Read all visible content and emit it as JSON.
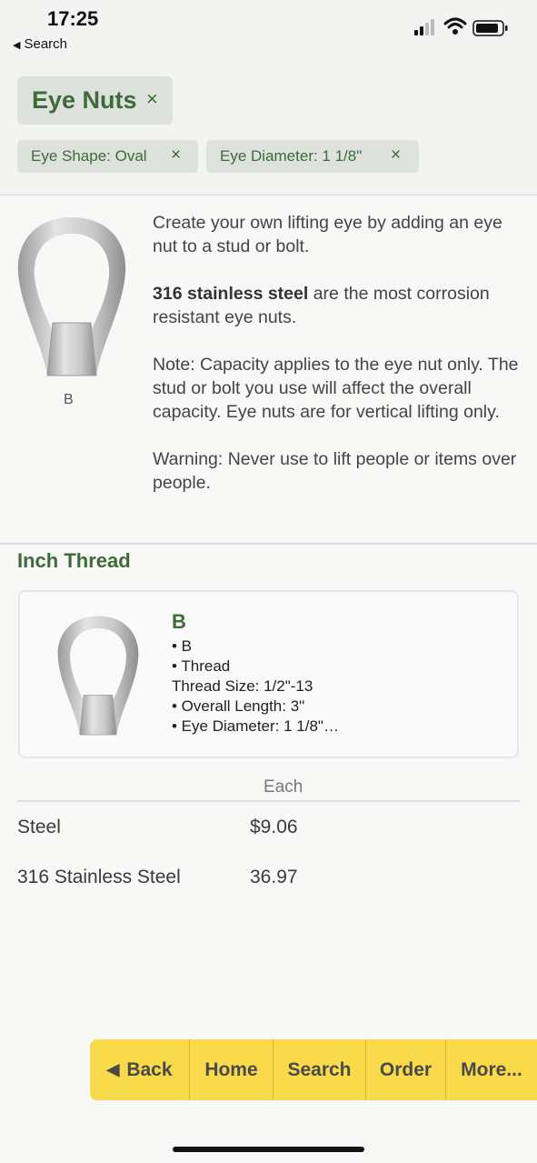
{
  "status": {
    "time": "17:25",
    "back_app": "Search",
    "back_icon": "back-triangle-icon"
  },
  "filters": {
    "main_label": "Eye Nuts",
    "chips": [
      {
        "label": "Eye Shape: Oval"
      },
      {
        "label": "Eye Diameter: 1 1/8\""
      }
    ],
    "remove_symbol": "×"
  },
  "intro": {
    "image_caption": "B",
    "para1": "Create your own lifting eye by adding an eye nut to a stud or bolt.",
    "para2_bold": "316 stainless steel",
    "para2_rest": " are the most corrosion resistant eye nuts.",
    "para3": "Note: Capacity applies to the eye nut only. The stud or bolt you use will affect the overall capacity. Eye nuts are for vertical lifting only.",
    "para4": "Warning: Never use to lift people or items over people."
  },
  "section": {
    "title": "Inch Thread"
  },
  "product": {
    "title": "B",
    "lines": [
      "• B",
      "• Thread",
      "Thread Size: 1/2\"-13",
      "• Overall Length: 3\"",
      "• Eye Diameter: 1 1/8\"…"
    ]
  },
  "pricing": {
    "column_header": "Each",
    "rows": [
      {
        "material": "Steel",
        "price": "$9.06"
      },
      {
        "material": "316 Stainless Steel",
        "price": "36.97"
      }
    ]
  },
  "toolbar": {
    "back": "Back",
    "home": "Home",
    "search": "Search",
    "order": "Order",
    "more": "More..."
  },
  "colors": {
    "accent_green": "#3f6a3a",
    "chip_bg": "#dde3dc",
    "toolbar_yellow": "#f8da4b"
  }
}
